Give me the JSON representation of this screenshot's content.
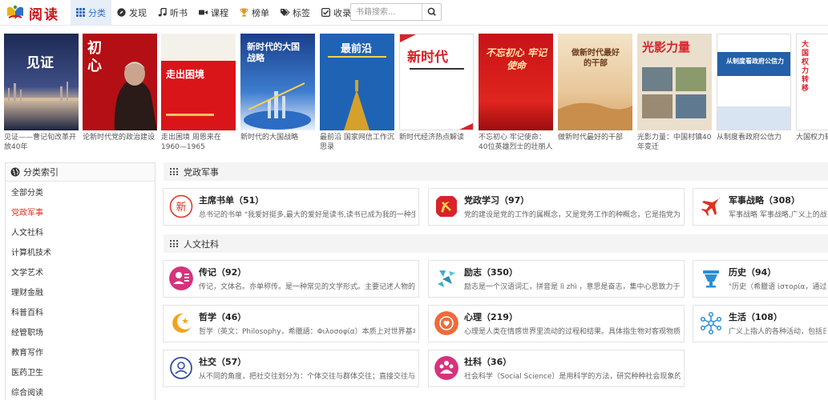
{
  "logo": {
    "text": "阅读"
  },
  "nav": {
    "items": [
      {
        "label": "分类",
        "icon": "grid-icon",
        "active": true
      },
      {
        "label": "发现",
        "icon": "compass-icon"
      },
      {
        "label": "听书",
        "icon": "music-icon"
      },
      {
        "label": "课程",
        "icon": "video-camera-icon"
      },
      {
        "label": "榜单",
        "icon": "trophy-icon"
      },
      {
        "label": "标签",
        "icon": "tags-icon"
      },
      {
        "label": "收录",
        "icon": "check-square-icon"
      }
    ],
    "search_placeholder": "书籍搜索..."
  },
  "books": [
    {
      "title": "见证——曹记旬改革开放40年",
      "cover_text": "见证"
    },
    {
      "title": "论新时代党的政治建设",
      "cover_text": "初心"
    },
    {
      "title": "走出困境 周恩来在 1960—1965",
      "cover_text": "走出困境"
    },
    {
      "title": "新时代的大国战略",
      "cover_text": "新时代的大国战略"
    },
    {
      "title": "最前沿 国家网信工作沉思录",
      "cover_text": "最前沿"
    },
    {
      "title": "新时代经济热点解读",
      "cover_text": "新时代"
    },
    {
      "title": "不忘初心 牢记使命：40位英雄烈士的壮丽人生",
      "cover_text": "不忘初心 牢记使命"
    },
    {
      "title": "做新时代最好的干部",
      "cover_text": "做新时代最好的干部"
    },
    {
      "title": "光影力量：中国村镇40年变迁",
      "cover_text": "光影力量"
    },
    {
      "title": "从制度看政府公信力",
      "cover_text": "从制度看政府公信力"
    },
    {
      "title": "大国权力转移",
      "cover_text": "大国权力转移"
    }
  ],
  "sidebar": {
    "header": "分类索引",
    "items": [
      "全部分类",
      "党政军事",
      "人文社科",
      "计算机技术",
      "文学艺术",
      "理财金融",
      "科普百科",
      "经管职场",
      "教育写作",
      "医药卫生",
      "综合阅读"
    ],
    "active_index": 1
  },
  "sections": [
    {
      "title": "党政军事",
      "cards": [
        {
          "name": "主席书单",
          "count": "（51）",
          "desc": "总书记的书单 \"我爱好挺多,最大的爱好是读书,读书已成为我的一种生活方式\"",
          "icon": "xin-badge-icon"
        },
        {
          "name": "党政学习",
          "count": "（97）",
          "desc": "党的建设是党的工作的属概念，又是党务工作的种概念，它是指党为保持自己的性质",
          "icon": "party-emblem-icon"
        },
        {
          "name": "军事战略",
          "count": "（308）",
          "desc": "军事战略 军事战略,广义上的战略泛指对战争全局的筹划和指导",
          "icon": "fighter-jet-icon"
        }
      ]
    },
    {
      "title": "人文社科",
      "cards": [
        {
          "name": "传记",
          "count": "（92）",
          "desc": "传记，文体名。亦单称传。是一种常见的文学形式。主要记述人物的生平事迹",
          "icon": "biography-icon"
        },
        {
          "name": "励志",
          "count": "（350）",
          "desc": "励志是一个汉语词汇，拼音是 lì zhì ，意思是奋志，集中心思致力于某种事业",
          "icon": "inspiration-icon"
        },
        {
          "name": "历史",
          "count": "（94）",
          "desc": "\"历史（希臘语 ἱστορία，通过调查获得的知识）\"",
          "icon": "history-icon"
        },
        {
          "name": "哲学",
          "count": "（46）",
          "desc": "哲学（英文：Philosophy，希臘語：Φιλοσοφία）本质上对世界基本和普遍之问题的研究",
          "icon": "philosophy-icon"
        },
        {
          "name": "心理",
          "count": "（219）",
          "desc": "心理是人类在情感世界里流动的过程和结果。具体指生物对客观物质世界的主观反映",
          "icon": "psychology-icon"
        },
        {
          "name": "生活",
          "count": "（108）",
          "desc": "广义上指人的各种活动，包括日常生活",
          "icon": "life-network-icon"
        },
        {
          "name": "社交",
          "count": "（57）",
          "desc": "从不同的角度，把社交往划分为：个体交往与群体交往；直接交往与间接交往",
          "icon": "social-icon"
        },
        {
          "name": "社科",
          "count": "（36）",
          "desc": "社会科学（Social Science）是用科学的方法，研究种种社会现象的各学科总称",
          "icon": "social-science-icon"
        }
      ]
    }
  ]
}
